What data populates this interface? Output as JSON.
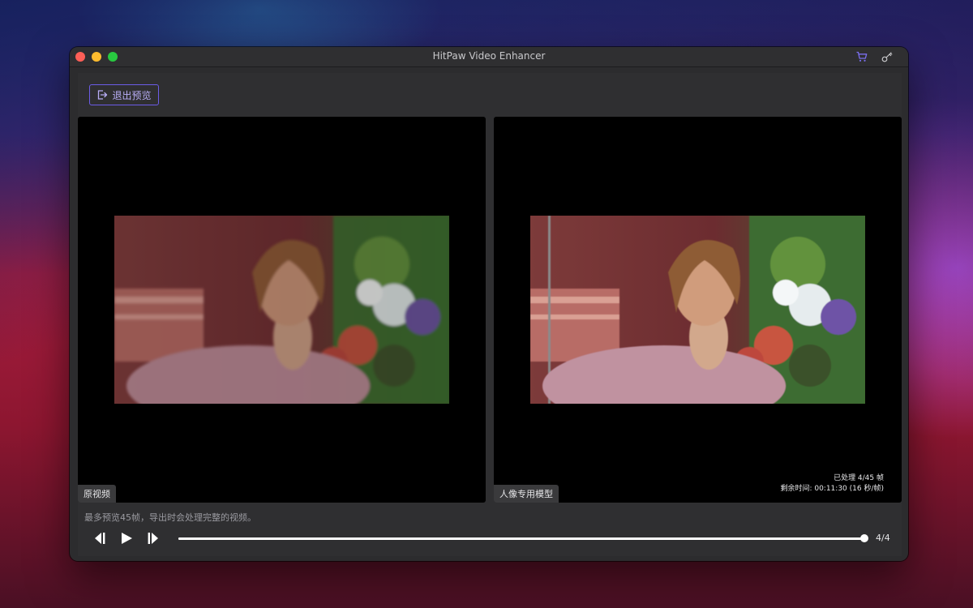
{
  "window": {
    "title": "HitPaw Video Enhancer"
  },
  "toolbar": {
    "exit_preview_label": "退出预览"
  },
  "panes": {
    "original_label": "原视频",
    "enhanced_label": "人像专用模型"
  },
  "status": {
    "processed": "已处理 4/45 帧",
    "remaining": "剩余时间: 00:11:30 (16 秒/帧)"
  },
  "note": "最多预览45帧，导出时会处理完整的视频。",
  "player": {
    "frame_count": "4/4",
    "progress": 1.0
  },
  "colors": {
    "accent": "#6c5ce7",
    "window_bg": "#2c2c2e",
    "pane_bg": "#000000"
  },
  "icons": {
    "cart": "cart-icon",
    "key": "key-icon",
    "exit": "exit-icon",
    "prev": "step-back-icon",
    "play": "play-icon",
    "next": "step-forward-icon"
  }
}
